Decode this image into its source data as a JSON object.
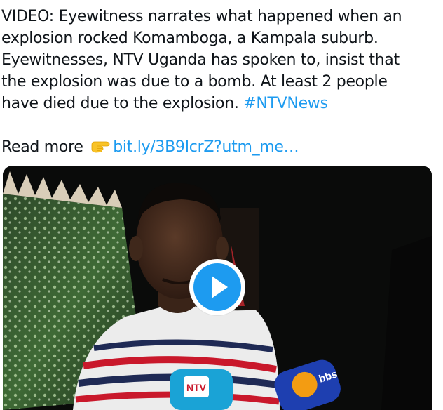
{
  "tweet": {
    "lines": [
      "VIDEO: Eyewitness narrates what happened when an",
      "explosion rocked Komamboga, a Kampala suburb.",
      "Eyewitnesses, NTV Uganda has spoken to, insist that",
      "the explosion was due to a bomb. At least 2 people",
      "have died due to the explosion. "
    ],
    "hashtag": "#NTVNews",
    "read_more_label": "Read more ",
    "link_text": "bit.ly/3B9IcrZ?utm_me…",
    "emoji": "backhand-index-pointing-right-icon"
  },
  "media": {
    "mic_ntv_label": "NTV",
    "mic_bbs_label": "bbs",
    "play_icon": "play-icon"
  },
  "colors": {
    "link": "#1d9bf0",
    "text": "#0f1419",
    "play_circle": "#1d9bf0"
  }
}
